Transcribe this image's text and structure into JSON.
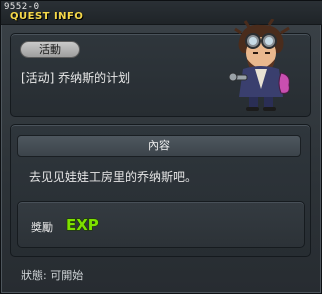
{
  "window": {
    "quest_id": "9552-0",
    "title": "QUEST INFO"
  },
  "quest": {
    "category_tag": "活動",
    "name": "[活动] 乔纳斯的计划",
    "npc_icon": "npc-jonas-portrait-icon"
  },
  "content": {
    "header": "內容",
    "description": "去见见娃娃工房里的乔纳斯吧。"
  },
  "reward": {
    "label": "獎勵",
    "exp_icon": "exp-icon",
    "exp_text": "EXP"
  },
  "status": {
    "text": "狀態: 可開始"
  },
  "colors": {
    "title": "#f5d84a",
    "exp_green": "#7ee000",
    "background": "#2d3338"
  }
}
